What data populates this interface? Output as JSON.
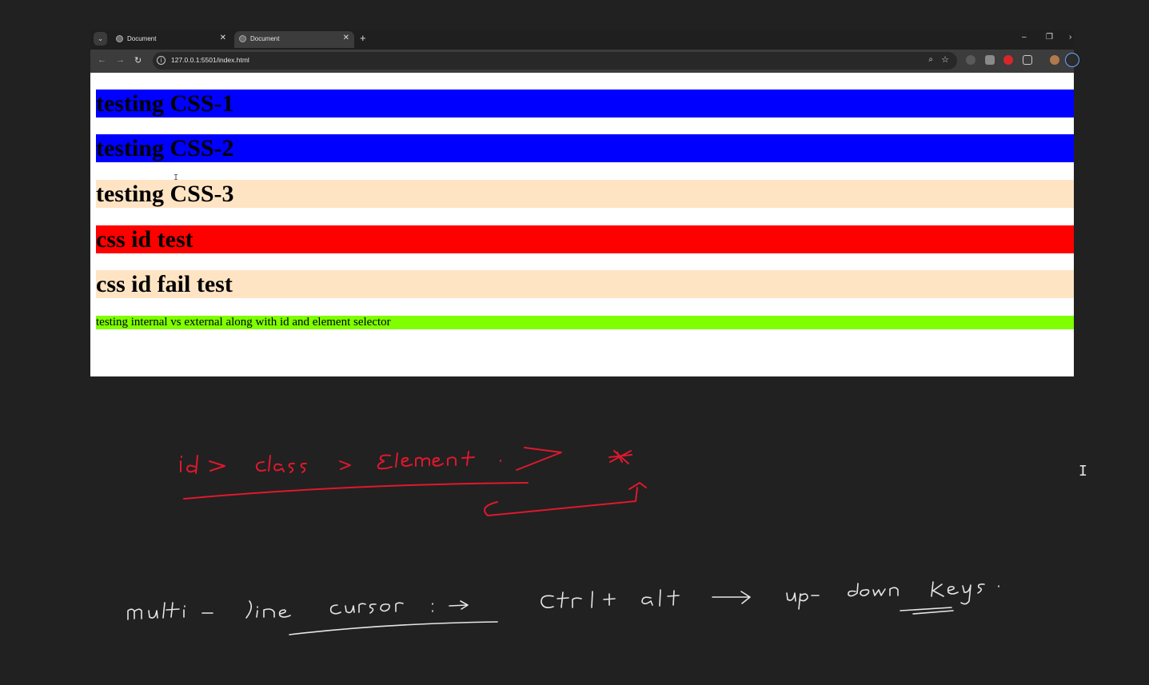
{
  "browser": {
    "tabs": [
      {
        "title": "Document",
        "active": false
      },
      {
        "title": "Document",
        "active": true
      }
    ],
    "url": "127.0.0.1:5501/index.html"
  },
  "page": {
    "headings": [
      {
        "text": "testing CSS-1",
        "background": "#0000ff"
      },
      {
        "text": "testing CSS-2",
        "background": "#0000ff"
      },
      {
        "text": "testing CSS-3",
        "background": "#ffe4c4"
      },
      {
        "text": "css id test",
        "background": "#ff0000"
      },
      {
        "text": "css id fail test",
        "background": "#ffe4c4"
      }
    ],
    "paragraph": {
      "text": "testing internal vs external along with id and element selector",
      "background": "#7fff00"
    }
  },
  "notes": {
    "line1": "id > class > Element . > *",
    "line2": "multi-line cursor :→ Ctrl+ alt → up-down keys .",
    "ink_color": "#e0182d"
  },
  "icons": [
    "tab-list-icon",
    "globe-icon",
    "close-icon",
    "plus-icon",
    "minimize-icon",
    "restore-icon",
    "back-icon",
    "forward-icon",
    "reload-icon",
    "site-info-icon",
    "zoom-icon",
    "star-icon",
    "extension-icon",
    "profile-icon",
    "menu-icon",
    "text-cursor-icon"
  ]
}
